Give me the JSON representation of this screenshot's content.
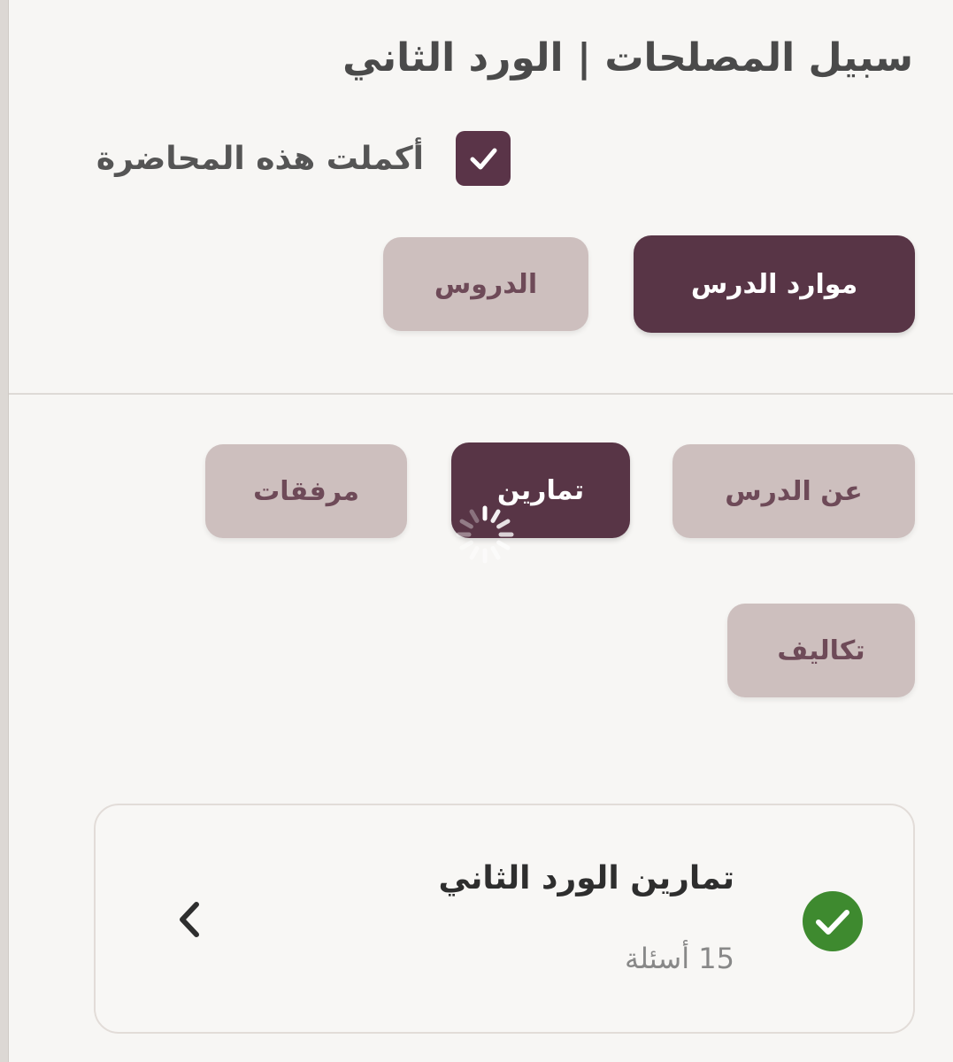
{
  "lesson": {
    "title": "سبيل المصلحات | الورد الثاني",
    "completed_label": "أكملت هذه المحاضرة",
    "completed": true
  },
  "primary_tabs": [
    {
      "label": "موارد الدرس",
      "active": true
    },
    {
      "label": "الدروس",
      "active": false
    }
  ],
  "secondary_tabs": [
    {
      "label": "عن الدرس",
      "active": false
    },
    {
      "label": "تمارين",
      "active": true
    },
    {
      "label": "مرفقات",
      "active": false
    },
    {
      "label": "تكاليف",
      "active": false
    }
  ],
  "exercise_card": {
    "title": "تمارين الورد الثاني",
    "count": "15 أسئلة",
    "status": "completed"
  },
  "icons": {
    "checkbox": "check-icon",
    "status": "check-circle-icon",
    "navigate": "chevron-left-icon",
    "loading": "spinner-icon"
  },
  "colors": {
    "primary": "#583546",
    "secondary": "#cdbfbe",
    "success": "#3e8a2f",
    "background": "#f7f6f4"
  }
}
